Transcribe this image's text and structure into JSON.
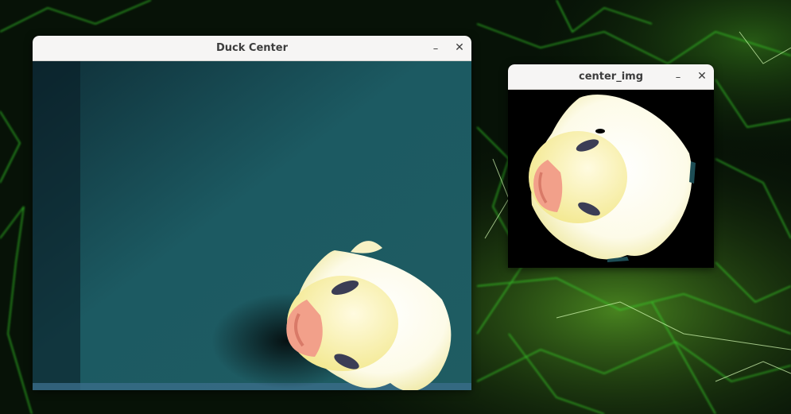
{
  "desktop": {
    "wallpaper": "green-neon-lightning",
    "accent": "#4cff3c"
  },
  "windows": {
    "duck_center": {
      "title": "Duck Center",
      "minimize_icon": "–",
      "close_icon": "✕",
      "image": "camera-view-duck-on-teal-board"
    },
    "center_img": {
      "title": "center_img",
      "minimize_icon": "–",
      "close_icon": "✕",
      "image": "cropped-duck-on-black"
    }
  }
}
